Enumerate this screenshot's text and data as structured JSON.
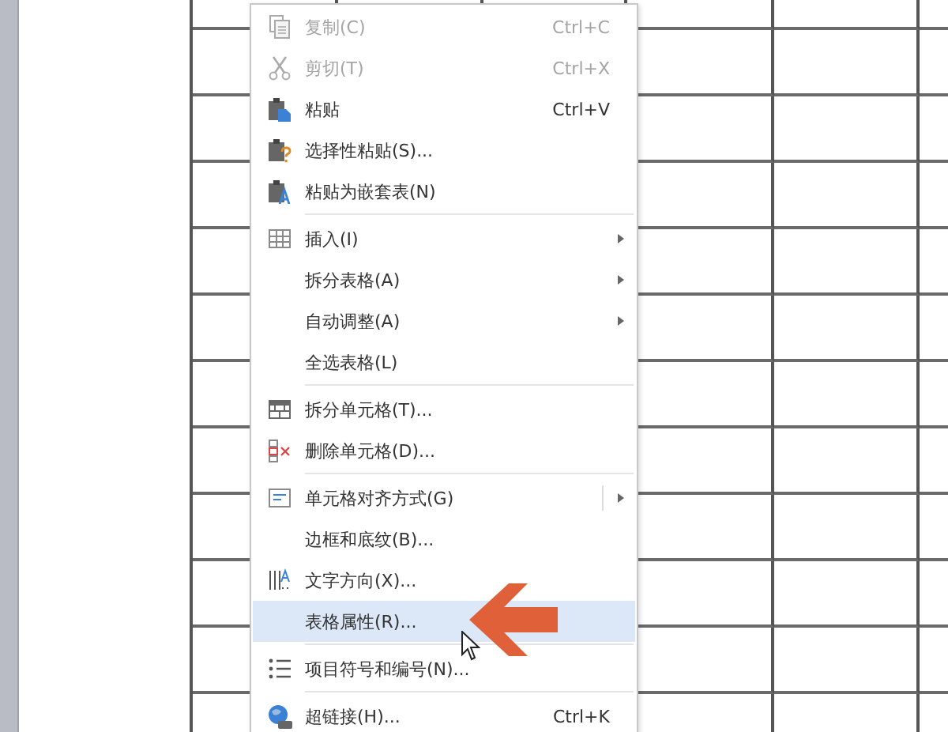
{
  "context_menu": {
    "items": [
      {
        "kind": "item",
        "label": "复制(C)",
        "shortcut": "Ctrl+C",
        "disabled": true,
        "submenu": false,
        "split": false,
        "selected": false
      },
      {
        "kind": "item",
        "label": "剪切(T)",
        "shortcut": "Ctrl+X",
        "disabled": true,
        "submenu": false,
        "split": false,
        "selected": false
      },
      {
        "kind": "item",
        "label": "粘贴",
        "shortcut": "Ctrl+V",
        "disabled": false,
        "submenu": false,
        "split": false,
        "selected": false
      },
      {
        "kind": "item",
        "label": "选择性粘贴(S)...",
        "disabled": false,
        "submenu": false,
        "split": false,
        "selected": false
      },
      {
        "kind": "item",
        "label": "粘贴为嵌套表(N)",
        "disabled": false,
        "submenu": false,
        "split": false,
        "selected": false
      },
      {
        "kind": "separator"
      },
      {
        "kind": "item",
        "label": "插入(I)",
        "disabled": false,
        "submenu": true,
        "split": false,
        "selected": false
      },
      {
        "kind": "item",
        "label": "拆分表格(A)",
        "disabled": false,
        "submenu": true,
        "split": false,
        "selected": false
      },
      {
        "kind": "item",
        "label": "自动调整(A)",
        "disabled": false,
        "submenu": true,
        "split": false,
        "selected": false
      },
      {
        "kind": "item",
        "label": "全选表格(L)",
        "disabled": false,
        "submenu": false,
        "split": false,
        "selected": false
      },
      {
        "kind": "separator"
      },
      {
        "kind": "item",
        "label": "拆分单元格(T)...",
        "disabled": false,
        "submenu": false,
        "split": false,
        "selected": false
      },
      {
        "kind": "item",
        "label": "删除单元格(D)...",
        "disabled": false,
        "submenu": false,
        "split": false,
        "selected": false
      },
      {
        "kind": "separator"
      },
      {
        "kind": "item",
        "label": "单元格对齐方式(G)",
        "disabled": false,
        "submenu": true,
        "split": true,
        "selected": false
      },
      {
        "kind": "item",
        "label": "边框和底纹(B)...",
        "disabled": false,
        "submenu": false,
        "split": false,
        "selected": false
      },
      {
        "kind": "item",
        "label": "文字方向(X)...",
        "disabled": false,
        "submenu": false,
        "split": false,
        "selected": false
      },
      {
        "kind": "item",
        "label": "表格属性(R)...",
        "disabled": false,
        "submenu": false,
        "split": false,
        "selected": true
      },
      {
        "kind": "separator"
      },
      {
        "kind": "item",
        "label": "项目符号和编号(N)...",
        "disabled": false,
        "submenu": false,
        "split": false,
        "selected": false
      },
      {
        "kind": "separator"
      },
      {
        "kind": "item",
        "label": "超链接(H)...",
        "shortcut": "Ctrl+K",
        "disabled": false,
        "submenu": false,
        "split": false,
        "selected": false
      }
    ]
  }
}
